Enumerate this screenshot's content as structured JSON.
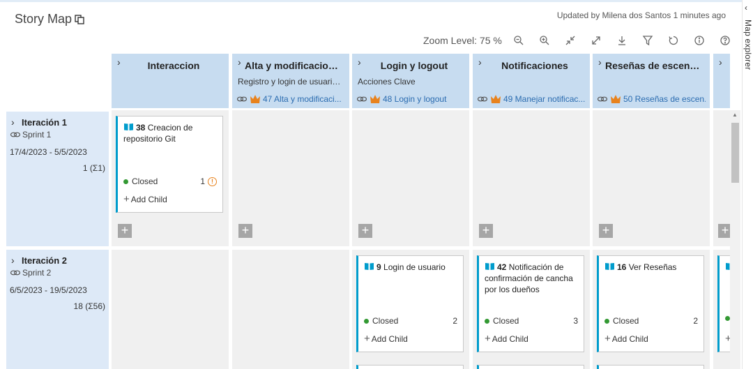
{
  "header": {
    "title": "Story Map",
    "updated": "Updated by Milena dos Santos 1 minutes ago",
    "zoom_label": "Zoom Level: 75 %"
  },
  "toolbar_icons": [
    "zoom-out-icon",
    "zoom-in-icon",
    "collapse-icon",
    "expand-icon",
    "download-icon",
    "filter-icon",
    "refresh-icon",
    "info-icon",
    "help-icon"
  ],
  "explorer": {
    "label": "Map explorer"
  },
  "columns": [
    {
      "name": "Interaccion",
      "desc": "",
      "link": ""
    },
    {
      "name": "Alta y modificacion ...",
      "desc": "Registro y login de usuario...",
      "link": "47 Alta y modificaci..."
    },
    {
      "name": "Login y logout",
      "desc": "Acciones Clave",
      "link": "48 Login y logout"
    },
    {
      "name": "Notificaciones",
      "desc": "",
      "link": "49 Manejar notificac..."
    },
    {
      "name": "Reseñas de escenari...",
      "desc": "",
      "link": "50 Reseñas de escen..."
    },
    {
      "name": "",
      "desc": "",
      "link": ""
    }
  ],
  "rows": [
    {
      "name": "Iteración 1",
      "sprint": "Sprint 1",
      "dates": "17/4/2023 - 5/5/2023",
      "count": "1 (Σ1)"
    },
    {
      "name": "Iteración 2",
      "sprint": "Sprint 2",
      "dates": "6/5/2023 - 19/5/2023",
      "count": "18 (Σ56)"
    }
  ],
  "cards": [
    {
      "id": "38",
      "title": "Creacion de repositorio Git",
      "status": "Closed",
      "count": "1",
      "add_child": "Add Child"
    },
    {
      "id": "9",
      "title": "Login de usuario",
      "status": "Closed",
      "count": "2",
      "add_child": "Add Child"
    },
    {
      "id": "42",
      "title": "Notificación de confirmación de cancha por los dueños",
      "status": "Closed",
      "count": "3",
      "add_child": "Add Child"
    },
    {
      "id": "16",
      "title": "Ver Reseñas",
      "status": "Closed",
      "count": "2",
      "add_child": "Add Child"
    }
  ],
  "colors": {
    "header_bg": "#c7dcf0",
    "row_bg": "#dde9f7",
    "cell_bg": "#f0f0f0",
    "card_accent": "#009ccc",
    "closed": "#339933",
    "crown": "#e8821c",
    "link": "#2b6cb0"
  }
}
